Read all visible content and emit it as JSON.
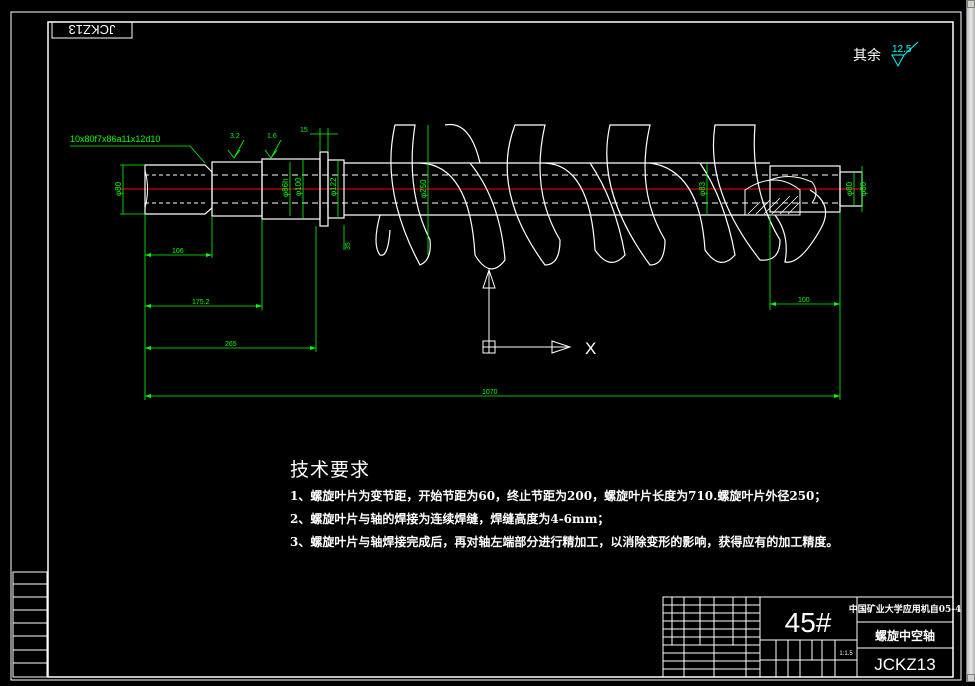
{
  "drawing": {
    "code_stamp": "JCKZ13",
    "surface_note": "其余",
    "surface_value": "12.5",
    "spline_label": "10x80f7x86a11x12d10",
    "roughness_marks": [
      "3.2",
      "1.6"
    ],
    "dims": {
      "d_left_small": "φ80",
      "d_seat1": "φ86h",
      "d_seat2": "φ100",
      "d_collar": "φ122",
      "d_pipe": "φ250",
      "d_shaft": "φ83",
      "d_right1": "φ80",
      "d_right2": "φ80",
      "top_15": "15",
      "side_35": "35",
      "len_106": "106",
      "len_1752": "175.2",
      "len_265": "265",
      "len_1070": "1070",
      "len_100": "100"
    },
    "axis_label": "X"
  },
  "tech_requirements": {
    "title": "技术要求",
    "items": [
      "1、螺旋叶片为变节距，开始节距为60，终止节距为200，螺旋叶片长度为710.螺旋叶片外径250；",
      "2、螺旋叶片与轴的焊接为连续焊缝，焊缝高度为4-6mm；",
      "3、螺旋叶片与轴焊接完成后，再对轴左端部分进行精加工，以消除变形的影响，获得应有的加工精度。"
    ]
  },
  "title_block": {
    "material": "45#",
    "school": "中国矿业大学应用机自05-4",
    "part_name": "螺旋中空轴",
    "drawing_code": "JCKZ13",
    "scale": "1:1.5"
  },
  "colors": {
    "frame": "#ffffff",
    "dimension": "#00ff00",
    "centerline": "#ff0000",
    "text": "#ffffff"
  }
}
